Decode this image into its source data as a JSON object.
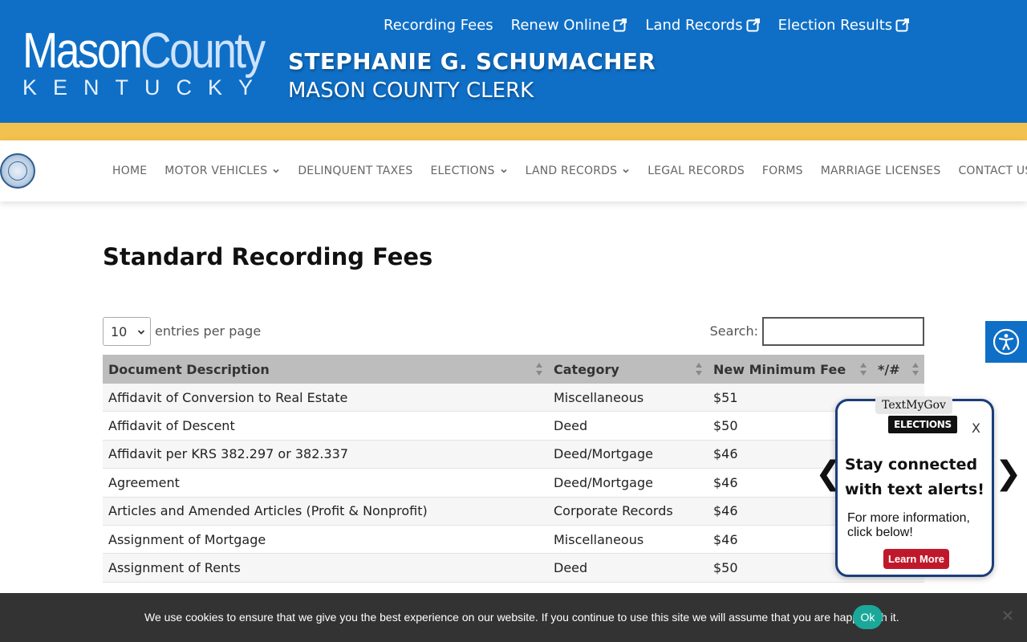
{
  "header": {
    "logo": {
      "word1": "Mason",
      "word2": "County",
      "state": "KENTUCKY"
    },
    "top_links": [
      "Recording Fees",
      "Renew Online",
      "Land Records",
      "Election Results"
    ],
    "clerk_name": "STEPHANIE G. SCHUMACHER",
    "clerk_title": "MASON COUNTY CLERK",
    "colors": {
      "primary": "#0f6fc6",
      "accent": "#f2c14e"
    }
  },
  "nav": {
    "items": [
      {
        "label": "HOME"
      },
      {
        "label": "MOTOR VEHICLES"
      },
      {
        "label": "DELINQUENT TAXES"
      },
      {
        "label": "ELECTIONS"
      },
      {
        "label": "LAND RECORDS"
      },
      {
        "label": "LEGAL RECORDS"
      },
      {
        "label": "FORMS"
      },
      {
        "label": "MARRIAGE LICENSES"
      },
      {
        "label": "CONTACT US"
      }
    ]
  },
  "main": {
    "title": "Standard Recording Fees",
    "entries_value": "10",
    "entries_label": "entries per page",
    "search_label": "Search:",
    "search_value": ""
  },
  "table": {
    "columns": [
      "Document Description",
      "Category",
      "New Minimum Fee",
      "*/#"
    ],
    "rows": [
      [
        "Affidavit of Conversion to Real Estate",
        "Miscellaneous",
        "$51",
        ""
      ],
      [
        "Affidavit of Descent",
        "Deed",
        "$50",
        ""
      ],
      [
        "Affidavit per KRS 382.297 or 382.337",
        "Deed/Mortgage",
        "$46",
        ""
      ],
      [
        "Agreement",
        "Deed/Mortgage",
        "$46",
        ""
      ],
      [
        "Articles and Amended Articles (Profit & Nonprofit)",
        "Corporate Records",
        "$46",
        ""
      ],
      [
        "Assignment of Mortgage",
        "Miscellaneous",
        "$46",
        ""
      ],
      [
        "Assignment of Rents",
        "Deed",
        "$50",
        ""
      ]
    ]
  },
  "textmygov": {
    "brand": "TextMyGov",
    "badge": "ELECTIONS",
    "close": "X",
    "headline": "Stay connected with text alerts!",
    "body": "For more information, click below!",
    "button": "Learn More",
    "prev": "❮",
    "next": "❯"
  },
  "cookie": {
    "text": "We use cookies to ensure that we give you the best experience on our website. If you continue to use this site we will assume that you are happy with it.",
    "ok": "Ok"
  }
}
